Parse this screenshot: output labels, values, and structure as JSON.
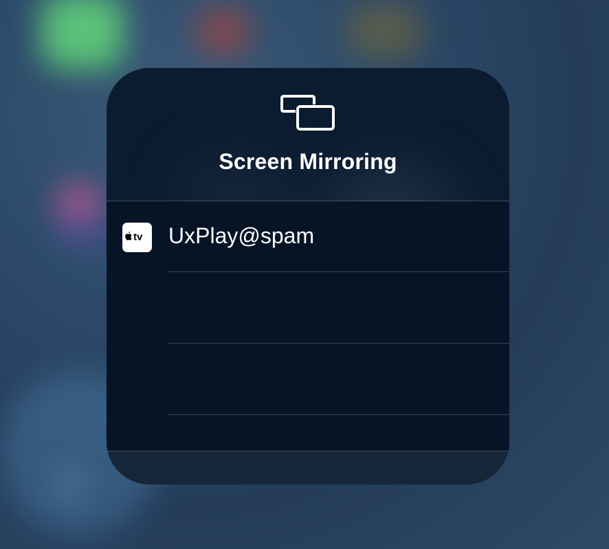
{
  "dialog": {
    "title": "Screen Mirroring",
    "icon": "screen-mirroring-icon"
  },
  "devices": [
    {
      "name": "UxPlay@spam",
      "icon": "apple-tv-icon",
      "badge_text": "tv"
    }
  ],
  "colors": {
    "panel": "#0c1c30",
    "text": "#ffffff",
    "separator": "#ffffff38"
  }
}
